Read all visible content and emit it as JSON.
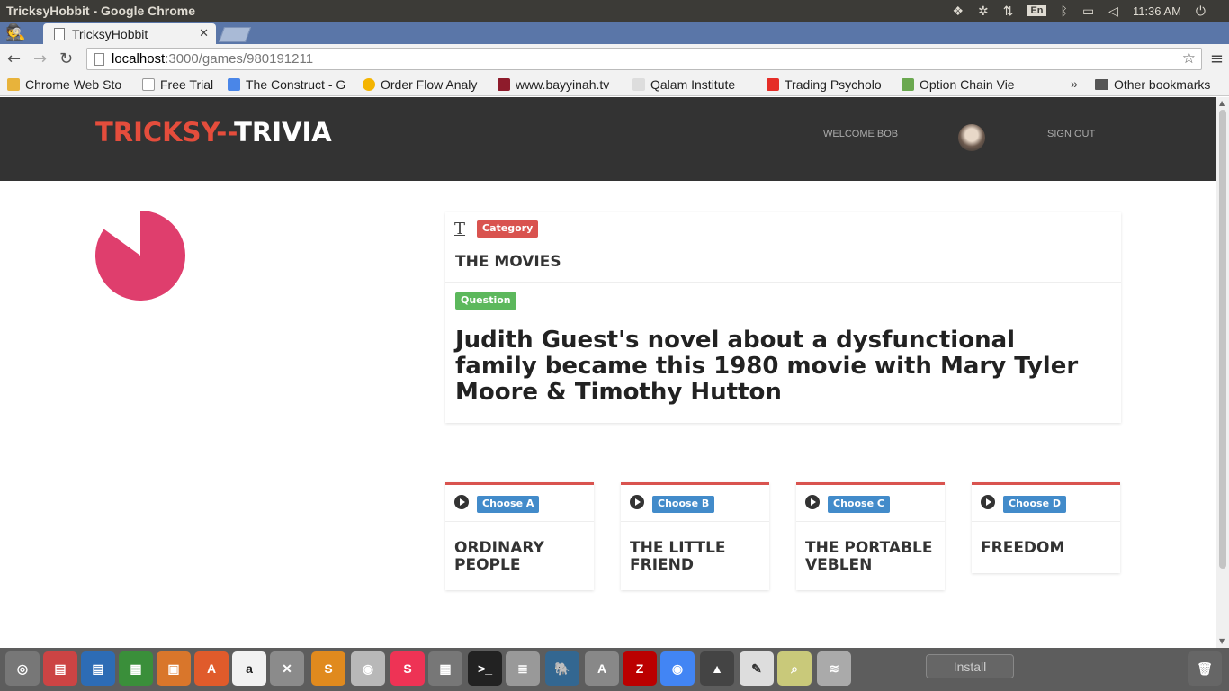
{
  "window": {
    "title": "TricksyHobbit - Google Chrome"
  },
  "tray": {
    "lang": "En",
    "clock": "11:36 AM"
  },
  "tabs": [
    {
      "label": "TricksyHobbit"
    }
  ],
  "toolbar": {
    "url_host": "localhost",
    "url_path": ":3000/games/980191211"
  },
  "bookmarks": {
    "items": [
      {
        "label": "Chrome Web Sto",
        "color": "#e8b33b"
      },
      {
        "label": "Free Trial",
        "color": "#ffffff"
      },
      {
        "label": "The Construct - G",
        "color": "#4a86e8"
      },
      {
        "label": "Order Flow Analy",
        "color": "#f4b400"
      },
      {
        "label": "www.bayyinah.tv",
        "color": "#8e1b2b"
      },
      {
        "label": "Qalam Institute",
        "color": "#dddddd"
      },
      {
        "label": "Trading Psycholo",
        "color": "#e52d27"
      },
      {
        "label": "Option Chain Vie",
        "color": "#6aa84f"
      }
    ],
    "more": "»",
    "other": "Other bookmarks"
  },
  "site": {
    "brand_part1": "TRICKSY",
    "brand_sep": "--",
    "brand_part2": "TRIVIA",
    "welcome": "WELCOME BOB",
    "sign_out": "SIGN OUT"
  },
  "timer": {
    "fraction_remaining": 0.85,
    "color": "#df3e6d"
  },
  "question": {
    "category_label": "Category",
    "category": "THE MOVIES",
    "question_label": "Question",
    "text": "Judith Guest's novel about a dysfunctional family became this 1980 movie with Mary Tyler Moore & Timothy Hutton"
  },
  "choices": [
    {
      "label": "Choose A",
      "answer": "ORDINARY PEOPLE"
    },
    {
      "label": "Choose B",
      "answer": "THE LITTLE FRIEND"
    },
    {
      "label": "Choose C",
      "answer": "THE PORTABLE VEBLEN"
    },
    {
      "label": "Choose D",
      "answer": "FREEDOM"
    }
  ],
  "dock": {
    "install_label": "Install"
  },
  "colors": {
    "brand_red": "#e54d3c",
    "header_bg": "#333333",
    "category_red": "#d9534f",
    "question_green": "#5cb85c",
    "choice_blue": "#428bca"
  }
}
